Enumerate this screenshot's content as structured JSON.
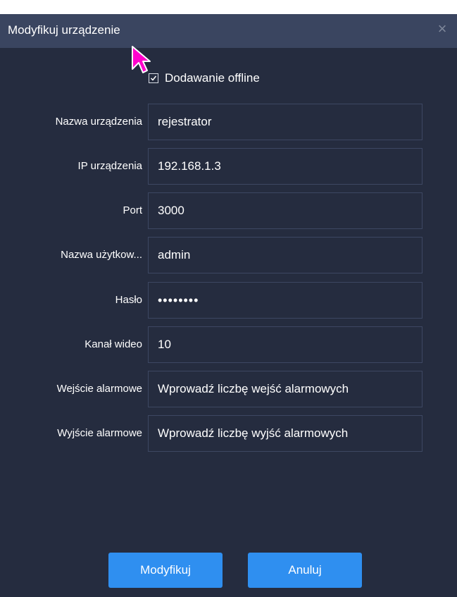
{
  "dialog": {
    "title": "Modyfikuj urządzenie",
    "close_glyph": "×",
    "offline_checkbox": {
      "label": "Dodawanie offline",
      "checked": true
    },
    "fields": [
      {
        "label": "Nazwa urządzenia",
        "value": "rejestrator"
      },
      {
        "label": "IP urządzenia",
        "value": "192.168.1.3"
      },
      {
        "label": "Port",
        "value": "3000"
      },
      {
        "label": "Nazwa użytkow...",
        "value": "admin"
      },
      {
        "label": "Hasło",
        "value": "••••••••"
      },
      {
        "label": "Kanał wideo",
        "value": "10"
      },
      {
        "label": "Wejście alarmowe",
        "placeholder": "Wprowadź liczbę wejść alarmowych"
      },
      {
        "label": "Wyjście alarmowe",
        "placeholder": "Wprowadź liczbę wyjść alarmowych"
      }
    ],
    "buttons": {
      "modify": "Modyfikuj",
      "cancel": "Anuluj"
    }
  },
  "colors": {
    "dialog_bg": "#252c3f",
    "titlebar_bg": "#3a4560",
    "field_border": "#3d4762",
    "button_bg": "#2f8ff0",
    "cursor": "#ff00cc"
  },
  "icons": {
    "close": "close-icon",
    "checkbox": "checkbox-checked-icon",
    "mouse": "mouse-pointer-icon"
  }
}
